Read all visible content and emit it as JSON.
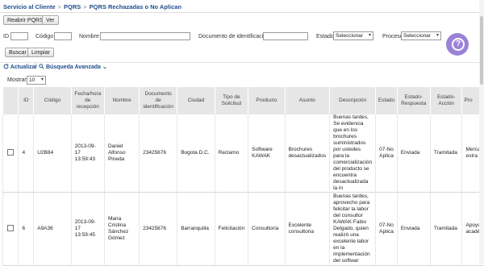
{
  "breadcrumb": {
    "items": [
      "Servicio al Cliente",
      "PQRS",
      "PQRS Rechazadas o No Aplican"
    ],
    "separator": ">"
  },
  "toolbar": {
    "reopen_label": "Reabrir PQRS",
    "view_label": "Ver"
  },
  "filters": {
    "id_label": "ID",
    "code_label": "Código",
    "name_label": "Nombre",
    "doc_label": "Documento de identificación",
    "status_label": "Estado",
    "status_value": "Seleccionar",
    "process_label": "Proceso",
    "process_value": "Seleccionar",
    "search_label": "Buscar",
    "clear_label": "Limpiar"
  },
  "actions": {
    "refresh_label": "Actualizar",
    "divider": "|",
    "advanced_label": "Búsqueda Avanzada"
  },
  "paging": {
    "show_label": "Mostrar",
    "show_value": "10"
  },
  "table": {
    "headers": [
      "",
      "ID",
      "Código",
      "Fecha/hora de recepción",
      "Nombre",
      "Documento de identificación",
      "Ciudad",
      "Tipo de Solicitud",
      "Producto",
      "Asunto",
      "Descripción",
      "Estado",
      "Estado-Respuesta",
      "Estado-Acción",
      "Pro"
    ],
    "rows": [
      {
        "id": "4",
        "code": "U2B84",
        "date": "2013-09-17 13:59:43",
        "name": "Daniel Alfonso Pineda",
        "doc": "23425676",
        "city": "Bogota D.C.",
        "type": "Reclamo",
        "product": "Software KAWAK",
        "subject": "Brochures desactualizados",
        "description": "Buenas tardes, Se evidencia que en los brochures suministrados por ustedes para la comercialización del producto se encuentra desactualizada la in",
        "status": "07-No Aplica",
        "response": "Enviada",
        "action": "Tramitada",
        "process": "Merca estra"
      },
      {
        "id": "6",
        "code": "A9A36",
        "date": "2013-09-17 13:59:45",
        "name": "Maria Cristina Sánchez Gómez",
        "doc": "23425676",
        "city": "Barranquilla",
        "type": "Felicitación",
        "product": "Consultoría",
        "subject": "Excelente consultoria",
        "description": "Buenas tardes, aprovecho para felicitar la labor del consultor KAWAK Fabio Delgado, quien realizó una excelente labor en la implementación del softwar",
        "status": "07-No Aplica",
        "response": "Enviada",
        "action": "Tramitada",
        "process": "Apoyo acadé"
      }
    ]
  },
  "colors": {
    "accent": "#1f4e8c",
    "help_button": "#9b82d6",
    "header_bg": "#e6e6e6"
  },
  "icons": {
    "refresh": "refresh-icon",
    "search": "magnifier-icon",
    "help": "question-mark-icon",
    "dropdown": "chevron-down-icon"
  }
}
